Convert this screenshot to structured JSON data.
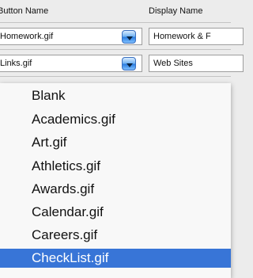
{
  "columns": {
    "button_name": "Button Name",
    "display_name": "Display Name"
  },
  "rows": [
    {
      "button": "Homework.gif",
      "display": "Homework & F"
    },
    {
      "button": "Links.gif",
      "display": "Web Sites"
    }
  ],
  "menu": {
    "items": [
      "Blank",
      "Academics.gif",
      "Art.gif",
      "Athletics.gif",
      "Awards.gif",
      "Calendar.gif",
      "Careers.gif",
      "CheckList.gif"
    ],
    "selected_index": 7
  },
  "colors": {
    "selection": "#3875d7",
    "arrow_button": "#2d7ee0"
  }
}
